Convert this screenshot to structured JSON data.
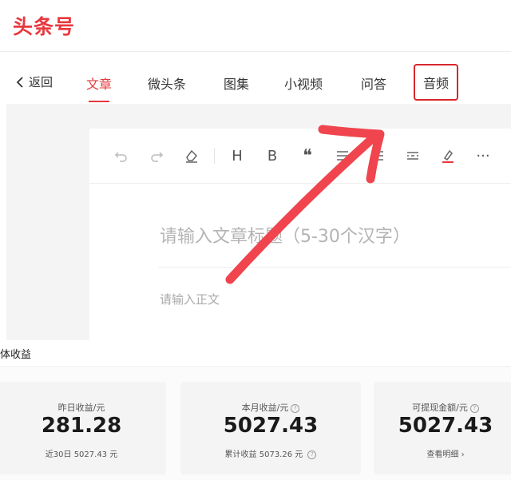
{
  "brand": {
    "logo": "头条号",
    "accent": "#e8383d"
  },
  "nav": {
    "back_label": "返回",
    "tabs": [
      {
        "label": "文章",
        "active": true
      },
      {
        "label": "微头条",
        "active": false
      },
      {
        "label": "图集",
        "active": false
      },
      {
        "label": "小视频",
        "active": false
      },
      {
        "label": "问答",
        "active": false
      },
      {
        "label": "音频",
        "active": false,
        "highlighted": true
      }
    ]
  },
  "toolbar": {
    "items": [
      "undo-icon",
      "redo-icon",
      "eraser-icon",
      "heading-icon",
      "bold-icon",
      "quote-icon",
      "list-icon",
      "align-icon",
      "divider-icon",
      "highlight-icon",
      "more-icon"
    ],
    "heading_glyph": "H",
    "bold_glyph": "B",
    "quote_glyph": "❝",
    "more_glyph": "···"
  },
  "editor": {
    "title_placeholder": "请输入文章标题（5-30个汉字）",
    "body_placeholder": "请输入正文"
  },
  "revenue": {
    "section_label": "体收益",
    "cards": [
      {
        "label": "昨日收益/元",
        "value": "281.28",
        "foot_label": "近30日",
        "foot_value": "5027.43 元"
      },
      {
        "label": "本月收益/元",
        "value": "5027.43",
        "foot_label": "累计收益",
        "foot_value": "5073.26 元"
      },
      {
        "label": "可提现金额/元",
        "value": "5027.43",
        "foot_label": "查看明细",
        "foot_value": "›"
      }
    ]
  }
}
